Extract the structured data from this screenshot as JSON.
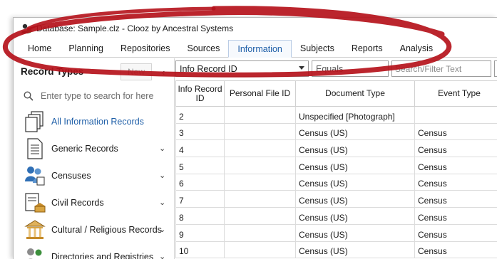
{
  "window": {
    "title": "Database: Sample.clz - Clooz by Ancestral Systems"
  },
  "menu": {
    "tabs": [
      {
        "label": "Home",
        "active": false
      },
      {
        "label": "Planning",
        "active": false
      },
      {
        "label": "Repositories",
        "active": false
      },
      {
        "label": "Sources",
        "active": false
      },
      {
        "label": "Information",
        "active": true
      },
      {
        "label": "Subjects",
        "active": false
      },
      {
        "label": "Reports",
        "active": false
      },
      {
        "label": "Analysis",
        "active": false
      }
    ]
  },
  "left_pane": {
    "title": "Record Types",
    "new_label": "New",
    "collapse_glyph": "‹",
    "search_placeholder": "Enter type to search for here",
    "items": [
      {
        "label": "All Information Records",
        "icon": "stacked-pages-icon",
        "selected": true,
        "expandable": false
      },
      {
        "label": "Generic Records",
        "icon": "document-icon",
        "selected": false,
        "expandable": true
      },
      {
        "label": "Censuses",
        "icon": "people-census-icon",
        "selected": false,
        "expandable": true
      },
      {
        "label": "Civil Records",
        "icon": "civil-building-icon",
        "selected": false,
        "expandable": true
      },
      {
        "label": "Cultural / Religious Records",
        "icon": "temple-icon",
        "selected": false,
        "expandable": true
      },
      {
        "label": "Directories and Registries",
        "icon": "people-directory-icon",
        "selected": false,
        "expandable": true
      }
    ]
  },
  "filter": {
    "field": "Info Record ID",
    "operator": "Equals",
    "placeholder": "Search/Filter Text"
  },
  "grid": {
    "columns": [
      "Info Record ID",
      "Personal File ID",
      "Document Type",
      "Event Type"
    ],
    "rows": [
      {
        "id": "2",
        "personal_file_id": "",
        "document_type": "Unspecified [Photograph]",
        "event_type": ""
      },
      {
        "id": "3",
        "personal_file_id": "",
        "document_type": "Census (US)",
        "event_type": "Census"
      },
      {
        "id": "4",
        "personal_file_id": "",
        "document_type": "Census (US)",
        "event_type": "Census"
      },
      {
        "id": "5",
        "personal_file_id": "",
        "document_type": "Census (US)",
        "event_type": "Census"
      },
      {
        "id": "6",
        "personal_file_id": "",
        "document_type": "Census (US)",
        "event_type": "Census"
      },
      {
        "id": "7",
        "personal_file_id": "",
        "document_type": "Census (US)",
        "event_type": "Census"
      },
      {
        "id": "8",
        "personal_file_id": "",
        "document_type": "Census (US)",
        "event_type": "Census"
      },
      {
        "id": "9",
        "personal_file_id": "",
        "document_type": "Census (US)",
        "event_type": "Census"
      },
      {
        "id": "10",
        "personal_file_id": "",
        "document_type": "Census (US)",
        "event_type": "Census"
      }
    ]
  },
  "colors": {
    "accent": "#1f5fa8",
    "ink_annotation": "#b5121b"
  }
}
